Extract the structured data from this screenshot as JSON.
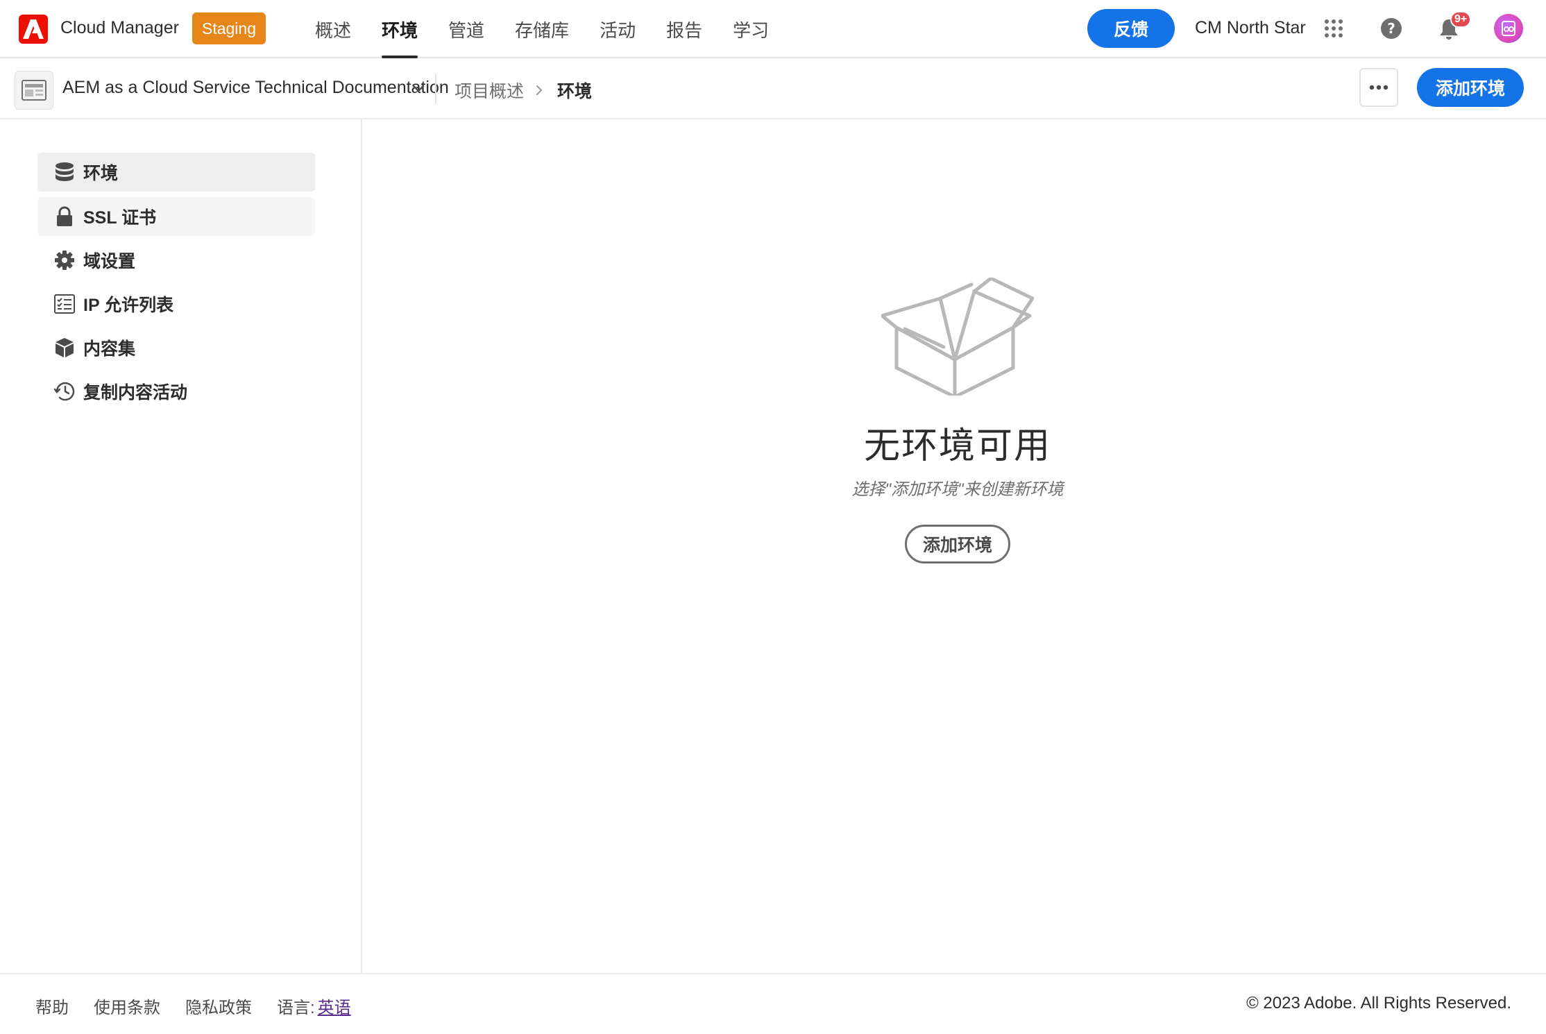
{
  "header": {
    "app_name": "Cloud Manager",
    "env_badge": "Staging",
    "nav": [
      {
        "label": "概述",
        "active": false
      },
      {
        "label": "环境",
        "active": true
      },
      {
        "label": "管道",
        "active": false
      },
      {
        "label": "存储库",
        "active": false
      },
      {
        "label": "活动",
        "active": false
      },
      {
        "label": "报告",
        "active": false
      },
      {
        "label": "学习",
        "active": false
      }
    ],
    "feedback_label": "反馈",
    "org_name": "CM North Star",
    "notifications_count": "9+",
    "icons": [
      "adobe-logo-icon",
      "app-grid-icon",
      "help-icon",
      "bell-icon",
      "avatar"
    ]
  },
  "subheader": {
    "program_name": "AEM as a Cloud Service Technical Documentation",
    "breadcrumb": {
      "parent": "项目概述",
      "current": "环境"
    },
    "add_environment_label": "添加环境"
  },
  "sidebar": {
    "items": [
      {
        "label": "环境",
        "icon": "database-icon",
        "active": true
      },
      {
        "label": "SSL 证书",
        "icon": "lock-icon",
        "active": false
      },
      {
        "label": "域设置",
        "icon": "gear-icon",
        "active": false
      },
      {
        "label": "IP 允许列表",
        "icon": "checklist-icon",
        "active": false
      },
      {
        "label": "内容集",
        "icon": "boxes-icon",
        "active": false
      },
      {
        "label": "复制内容活动",
        "icon": "history-icon",
        "active": false
      }
    ]
  },
  "empty_state": {
    "title": "无环境可用",
    "description": "选择\"添加环境\"来创建新环境",
    "button_label": "添加环境"
  },
  "footer": {
    "help": "帮助",
    "terms": "使用条款",
    "privacy": "隐私政策",
    "language_label": "语言:",
    "language_value": "英语",
    "copyright": "© 2023 Adobe. All Rights Reserved."
  },
  "colors": {
    "accent": "#1473e6",
    "staging": "#e68619",
    "adobe_red": "#eb1000",
    "badge_red": "#e34850"
  }
}
